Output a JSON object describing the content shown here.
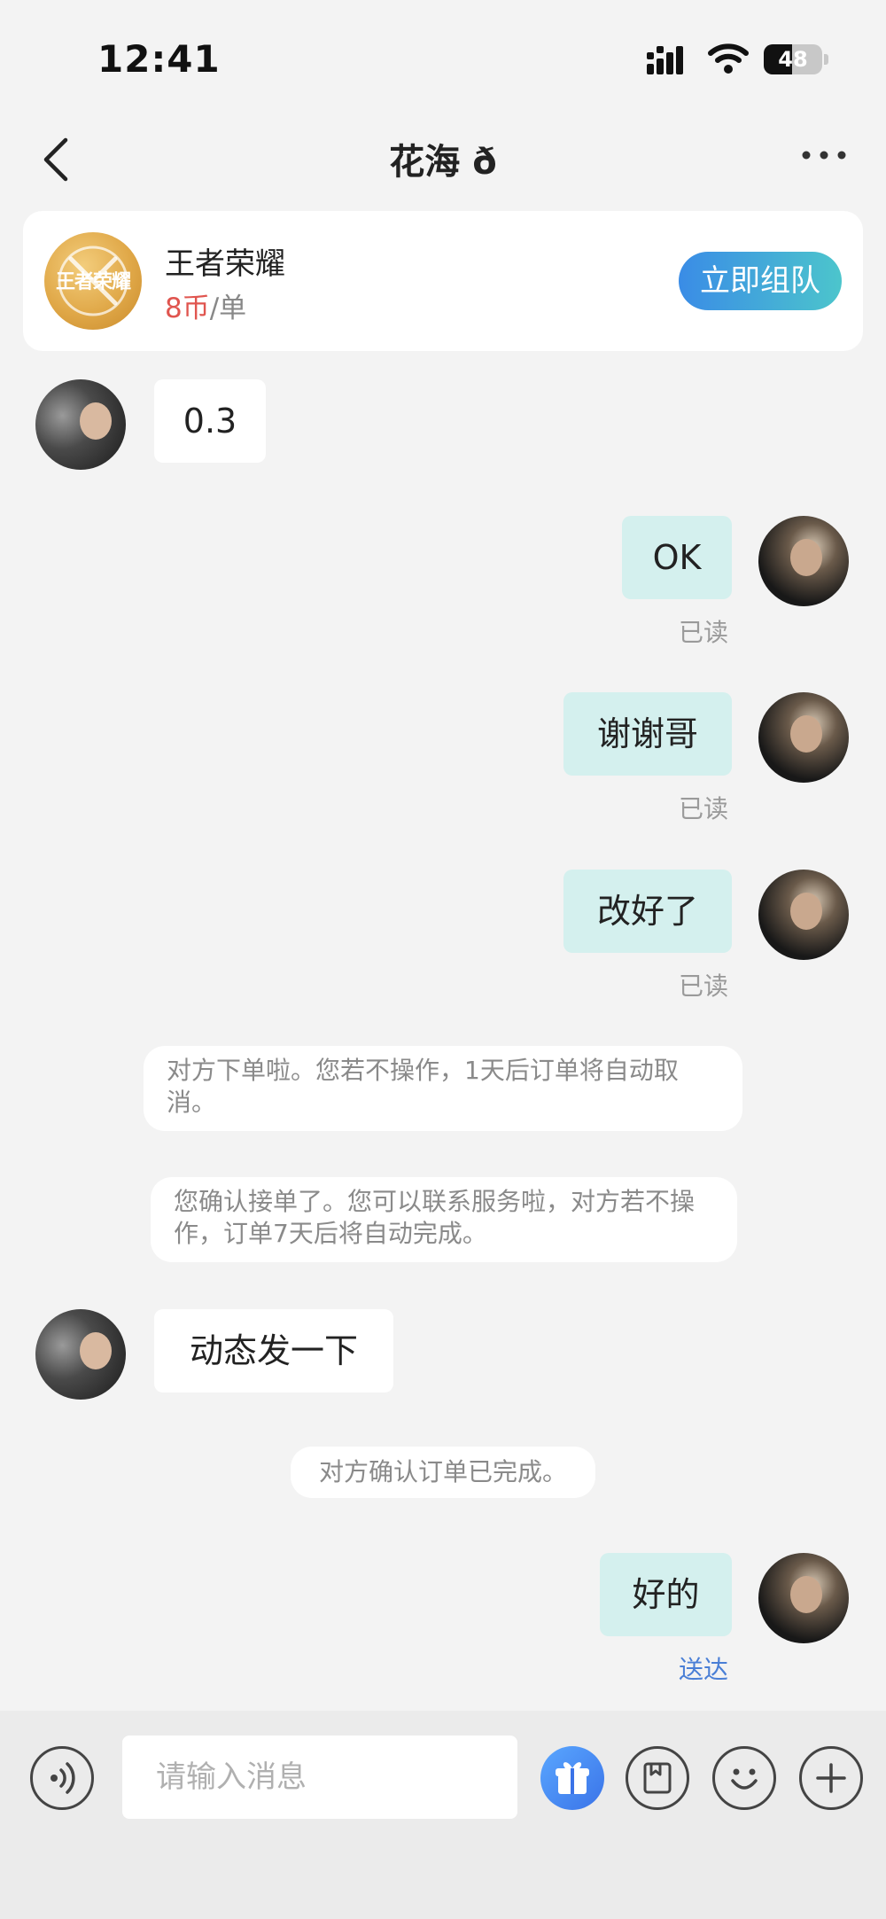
{
  "status_bar": {
    "time": "12:41",
    "battery_level": "48",
    "icons": [
      "cellular-signal-icon",
      "wifi-icon",
      "battery-icon"
    ]
  },
  "nav": {
    "title": "花海 ð",
    "back_icon": "chevron-left-icon",
    "more_icon": "more-dots-icon"
  },
  "game_card": {
    "logo_text": "王者荣耀",
    "name": "王者荣耀",
    "price_coin": "8币",
    "price_unit": "/单",
    "team_button_label": "立即组队"
  },
  "messages": [
    {
      "side": "in",
      "text": "0.3"
    },
    {
      "side": "out",
      "text": "OK",
      "status": "已读"
    },
    {
      "side": "out",
      "text": "谢谢哥",
      "status": "已读"
    },
    {
      "side": "out",
      "text": "改好了",
      "status": "已读"
    },
    {
      "side": "system",
      "text": "对方下单啦。您若不操作，1天后订单将自动取消。"
    },
    {
      "side": "system",
      "text": "您确认接单了。您可以联系服务啦，对方若不操作，订单7天后将自动完成。"
    },
    {
      "side": "in",
      "text": "动态发一下"
    },
    {
      "side": "system",
      "text": "对方确认订单已完成。"
    },
    {
      "side": "out",
      "text": "好的",
      "status": "送达"
    }
  ],
  "input_bar": {
    "placeholder": "请输入消息",
    "icons": [
      "voice-icon",
      "gift-icon",
      "album-icon",
      "emoji-icon",
      "plus-icon"
    ]
  },
  "colors": {
    "background": "#f3f3f3",
    "outgoing_bubble": "#d4f0ee",
    "incoming_bubble": "#ffffff",
    "coin_price": "#e0554f",
    "delivered_status": "#4a7fd6",
    "team_button_gradient": [
      "#3a8ce6",
      "#4cc5cc"
    ]
  }
}
